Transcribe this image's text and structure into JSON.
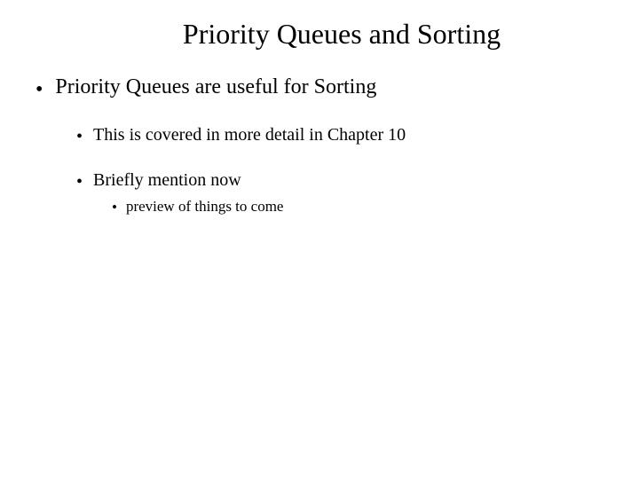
{
  "slide": {
    "title": "Priority Queues and Sorting",
    "bullets": {
      "b1": "Priority Queues are useful for Sorting",
      "b2": "This is covered in more detail in Chapter 10",
      "b3": "Briefly mention now",
      "b4": "preview of things to come"
    }
  }
}
